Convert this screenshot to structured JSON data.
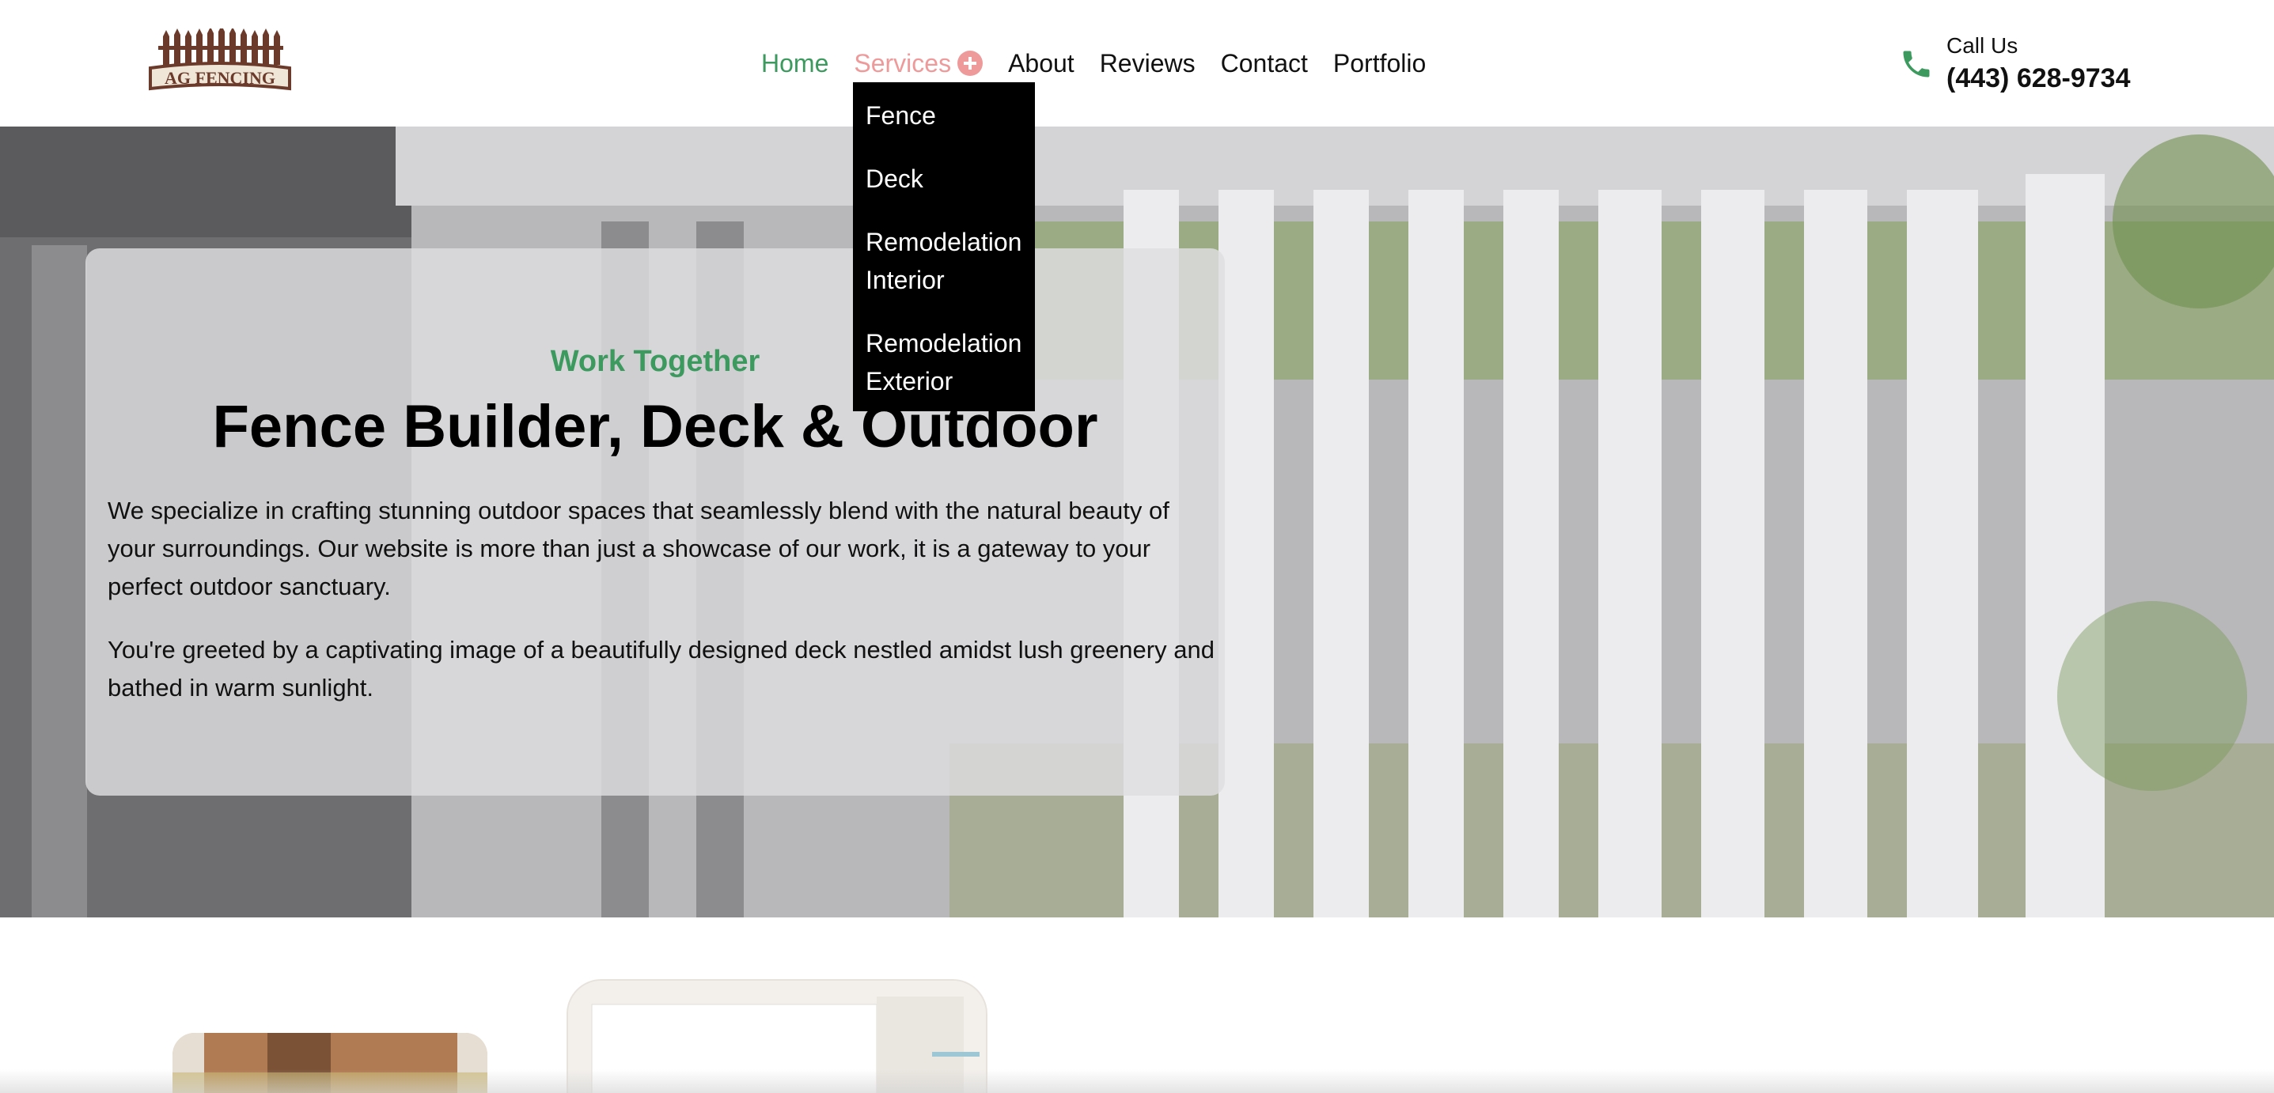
{
  "brand": {
    "logo_text": "AG FENCING",
    "logo_color": "#6b3a2a"
  },
  "nav": {
    "items": [
      {
        "label": "Home"
      },
      {
        "label": "Services"
      },
      {
        "label": "About"
      },
      {
        "label": "Reviews"
      },
      {
        "label": "Contact"
      },
      {
        "label": "Portfolio"
      }
    ],
    "active_color": "#3c9a5f",
    "hover_color": "#ef9a9a"
  },
  "services_dropdown": {
    "items": [
      {
        "label": "Fence"
      },
      {
        "label": "Deck"
      },
      {
        "label": "Remodelation Interior"
      },
      {
        "label": "Remodelation Exterior"
      }
    ]
  },
  "contact": {
    "label": "Call Us",
    "phone": "(443) 628-9734",
    "icon": "phone-icon",
    "icon_color": "#3c9a5f"
  },
  "hero": {
    "eyebrow": "Work Together",
    "title": "Fence Builder, Deck & Outdoor",
    "paragraphs": [
      "We specialize in crafting stunning outdoor spaces that seamlessly blend with the natural beauty of your surroundings. Our website is more than just a showcase of our work, it is a gateway to your perfect outdoor sanctuary.",
      "You're greeted by a captivating image of a beautifully designed deck nestled amidst lush greenery and bathed in warm sunlight."
    ]
  }
}
